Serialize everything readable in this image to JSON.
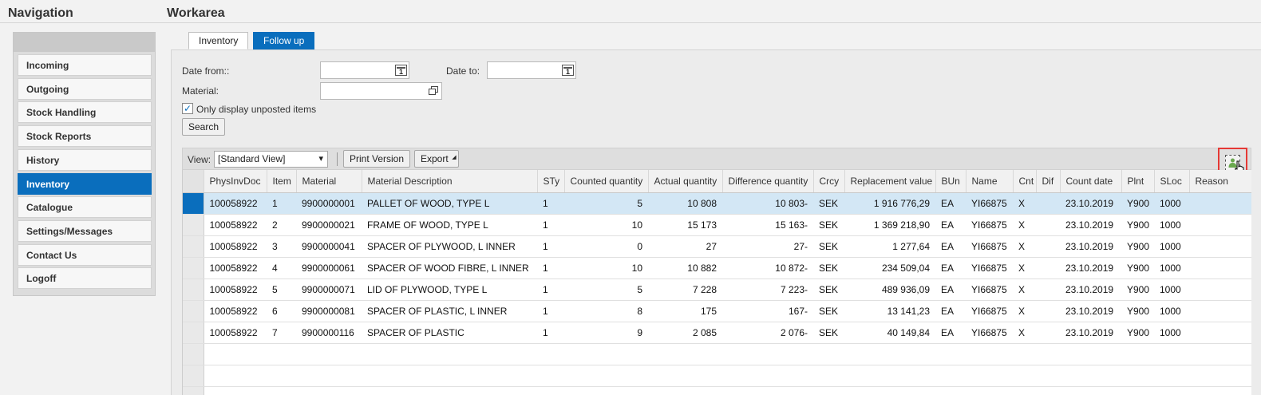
{
  "nav_title": "Navigation",
  "work_title": "Workarea",
  "nav_items": [
    {
      "label": "Incoming"
    },
    {
      "label": "Outgoing"
    },
    {
      "label": "Stock Handling"
    },
    {
      "label": "Stock Reports"
    },
    {
      "label": "History"
    },
    {
      "label": "Inventory",
      "active": true
    },
    {
      "label": "Catalogue"
    },
    {
      "label": "Settings/Messages"
    },
    {
      "label": "Contact Us"
    },
    {
      "label": "Logoff"
    }
  ],
  "tabs": {
    "inventory": "Inventory",
    "followup": "Follow up"
  },
  "filters": {
    "date_from_label": "Date from::",
    "date_from_value": "",
    "date_to_label": "Date to:",
    "date_to_value": "",
    "material_label": "Material:",
    "material_value": "",
    "only_unposted_label": "Only display unposted items",
    "only_unposted_checked": true,
    "search_label": "Search"
  },
  "toolbar": {
    "view_label": "View:",
    "view_value": "[Standard View]",
    "print_label": "Print Version",
    "export_label": "Export"
  },
  "table": {
    "columns": [
      "PhysInvDoc",
      "Item",
      "Material",
      "Material Description",
      "STy",
      "Counted quantity",
      "Actual quantity",
      "Difference quantity",
      "Crcy",
      "Replacement value",
      "BUn",
      "Name",
      "Cnt",
      "Dif",
      "Count date",
      "Plnt",
      "SLoc",
      "Reason"
    ],
    "rows": [
      [
        "100058922",
        "1",
        "9900000001",
        "PALLET OF WOOD, TYPE L",
        "1",
        "5",
        "10 808",
        "10 803-",
        "SEK",
        "1 916 776,29",
        "EA",
        "YI66875",
        "X",
        "",
        "23.10.2019",
        "Y900",
        "1000",
        ""
      ],
      [
        "100058922",
        "2",
        "9900000021",
        "FRAME OF WOOD, TYPE L",
        "1",
        "10",
        "15 173",
        "15 163-",
        "SEK",
        "1 369 218,90",
        "EA",
        "YI66875",
        "X",
        "",
        "23.10.2019",
        "Y900",
        "1000",
        ""
      ],
      [
        "100058922",
        "3",
        "9900000041",
        "SPACER OF PLYWOOD, L INNER",
        "1",
        "0",
        "27",
        "27-",
        "SEK",
        "1 277,64",
        "EA",
        "YI66875",
        "X",
        "",
        "23.10.2019",
        "Y900",
        "1000",
        ""
      ],
      [
        "100058922",
        "4",
        "9900000061",
        "SPACER OF WOOD FIBRE, L INNER",
        "1",
        "10",
        "10 882",
        "10 872-",
        "SEK",
        "234 509,04",
        "EA",
        "YI66875",
        "X",
        "",
        "23.10.2019",
        "Y900",
        "1000",
        ""
      ],
      [
        "100058922",
        "5",
        "9900000071",
        "LID OF PLYWOOD, TYPE L",
        "1",
        "5",
        "7 228",
        "7 223-",
        "SEK",
        "489 936,09",
        "EA",
        "YI66875",
        "X",
        "",
        "23.10.2019",
        "Y900",
        "1000",
        ""
      ],
      [
        "100058922",
        "6",
        "9900000081",
        "SPACER OF PLASTIC, L INNER",
        "1",
        "8",
        "175",
        "167-",
        "SEK",
        "13 141,23",
        "EA",
        "YI66875",
        "X",
        "",
        "23.10.2019",
        "Y900",
        "1000",
        ""
      ],
      [
        "100058922",
        "7",
        "9900000116",
        "SPACER OF PLASTIC",
        "1",
        "9",
        "2 085",
        "2 076-",
        "SEK",
        "40 149,84",
        "EA",
        "YI66875",
        "X",
        "",
        "23.10.2019",
        "Y900",
        "1000",
        ""
      ]
    ],
    "selected_row": 0
  },
  "colors": {
    "accent": "#0a6ebd",
    "selected_row": "#d3e7f5",
    "highlight_border": "#e53935"
  }
}
